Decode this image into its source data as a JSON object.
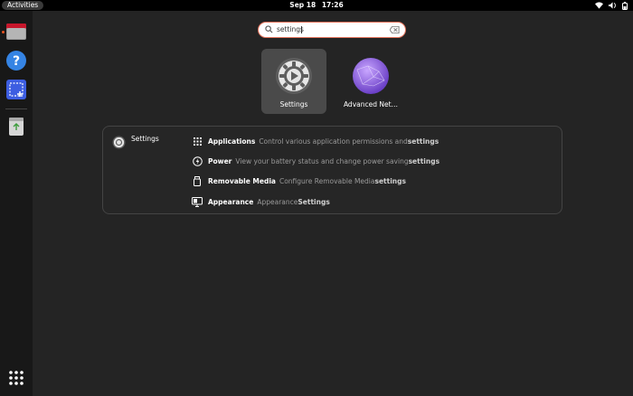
{
  "topbar": {
    "activities": "Activities",
    "date": "Sep 18",
    "time": "17:26"
  },
  "search": {
    "value": "settings",
    "placeholder": ""
  },
  "apps": [
    {
      "label": "Settings",
      "icon": "settings-gear-icon",
      "selected": true
    },
    {
      "label": "Advanced Net…",
      "icon": "network-icon",
      "selected": false
    }
  ],
  "provider": {
    "name": "Settings"
  },
  "results": [
    {
      "title": "Applications",
      "desc": "Control various application permissions and ",
      "highlight": "settings",
      "icon": "apps-grid-icon"
    },
    {
      "title": "Power",
      "desc": "View your battery status and change power saving ",
      "highlight": "settings",
      "icon": "power-icon"
    },
    {
      "title": "Removable Media",
      "desc": "Configure Removable Media ",
      "highlight": "settings",
      "icon": "removable-media-icon"
    },
    {
      "title": "Appearance",
      "desc": "Appearance ",
      "highlight": "Settings",
      "icon": "appearance-icon"
    }
  ],
  "colors": {
    "accent": "#e95420",
    "search_border": "#e2725b"
  }
}
